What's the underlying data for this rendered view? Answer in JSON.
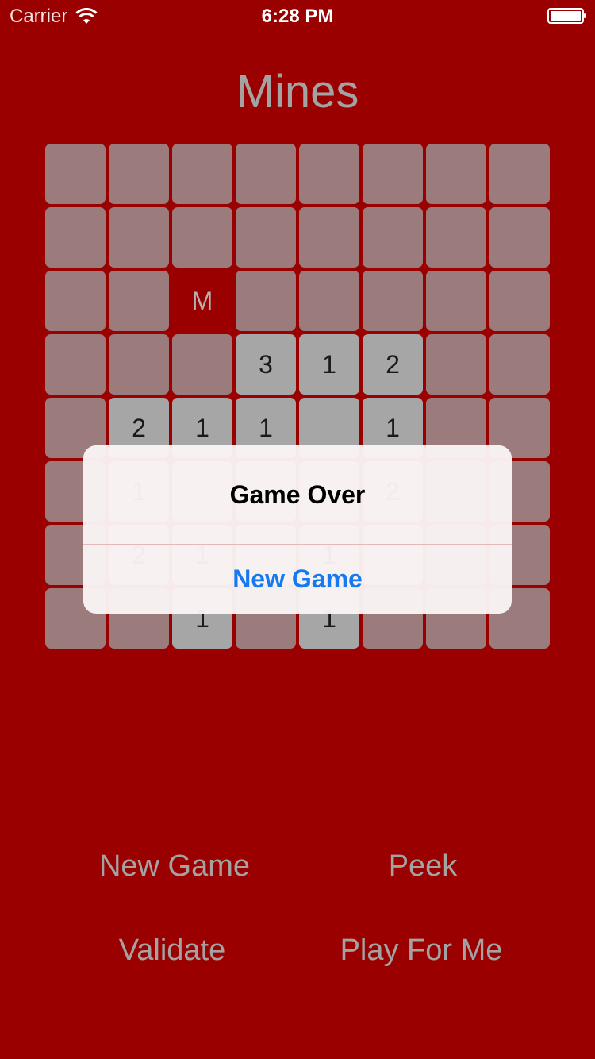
{
  "status_bar": {
    "carrier": "Carrier",
    "time": "6:28 PM",
    "wifi_icon": "wifi-icon",
    "battery_icon": "battery-icon"
  },
  "title": "Mines",
  "board": {
    "rows": 8,
    "cols": 8,
    "cells": [
      [
        "",
        "",
        "",
        "",
        "",
        "",
        "",
        ""
      ],
      [
        "",
        "",
        "",
        "",
        "",
        "",
        "",
        ""
      ],
      [
        "",
        "",
        "M",
        "",
        "",
        "",
        "",
        ""
      ],
      [
        "",
        "",
        "",
        "3",
        "1",
        "2",
        "",
        ""
      ],
      [
        "",
        "2",
        "1",
        "1",
        "",
        "1",
        "",
        ""
      ],
      [
        "",
        "1",
        "",
        "",
        "",
        "2",
        "",
        ""
      ],
      [
        "",
        "2",
        "1",
        "",
        "1",
        "",
        "",
        ""
      ],
      [
        "",
        "",
        "1",
        "",
        "1",
        "",
        "",
        ""
      ]
    ],
    "states": [
      [
        "hidden",
        "hidden",
        "hidden",
        "hidden",
        "hidden",
        "hidden",
        "hidden",
        "hidden"
      ],
      [
        "hidden",
        "hidden",
        "hidden",
        "hidden",
        "hidden",
        "hidden",
        "hidden",
        "hidden"
      ],
      [
        "hidden",
        "hidden",
        "mine",
        "hidden",
        "hidden",
        "hidden",
        "hidden",
        "hidden"
      ],
      [
        "hidden",
        "hidden",
        "hidden",
        "open",
        "open",
        "open",
        "hidden",
        "hidden"
      ],
      [
        "hidden",
        "open",
        "open",
        "open",
        "open",
        "open",
        "hidden",
        "hidden"
      ],
      [
        "hidden",
        "open",
        "open",
        "open",
        "open",
        "open",
        "hidden",
        "hidden"
      ],
      [
        "hidden",
        "open",
        "open",
        "open",
        "open",
        "open",
        "hidden",
        "hidden"
      ],
      [
        "hidden",
        "hidden",
        "open",
        "hidden",
        "open",
        "hidden",
        "hidden",
        "hidden"
      ]
    ]
  },
  "alert": {
    "title": "Game Over",
    "button_label": "New Game"
  },
  "controls": {
    "new_game": "New Game",
    "peek": "Peek",
    "validate": "Validate",
    "play_for_me": "Play For Me"
  },
  "colors": {
    "background": "#9b0000",
    "hidden_cell": "#9b7b7b",
    "open_cell": "#a6a6a6",
    "text_muted": "#a3a3a3",
    "alert_button": "#1579f0"
  }
}
